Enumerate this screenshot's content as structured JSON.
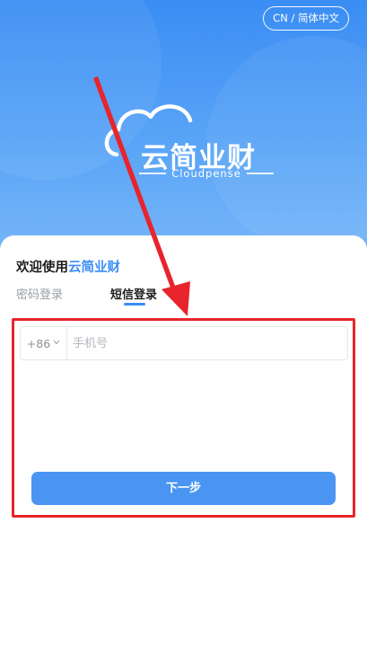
{
  "header": {
    "language_button": "CN / 简体中文"
  },
  "logo": {
    "name_cn": "云简业财",
    "name_en": "Cloudpense"
  },
  "login": {
    "welcome_prefix": "欢迎使用",
    "welcome_brand": "云简业财",
    "tabs": [
      {
        "label": "密码登录",
        "active": false
      },
      {
        "label": "短信登录",
        "active": true
      }
    ],
    "country_code": "+86",
    "phone_placeholder": "手机号",
    "next_button": "下一步"
  },
  "colors": {
    "brand_blue": "#3a8df3",
    "button_blue": "#4a95f2",
    "annotation_red": "#e8242c"
  },
  "icons": {
    "country_code_dropdown": "chevron-down-icon",
    "logo_mark": "cloud-logo-icon"
  }
}
